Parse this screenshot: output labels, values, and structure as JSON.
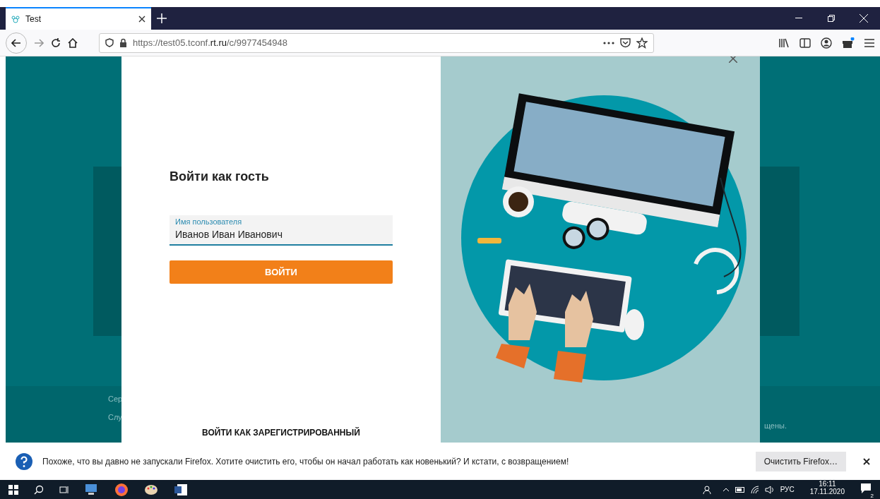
{
  "browser": {
    "tabs": [
      {
        "title": "Test",
        "selected": true
      }
    ],
    "url_prefix": "https://test05.tconf.",
    "url_domain": "rt.ru",
    "url_path": "/c/9977454948"
  },
  "background": {
    "footer_lines": [
      "Сер",
      "Слу"
    ],
    "copyright_tail": "щены."
  },
  "dialog": {
    "title": "Войти как гость",
    "field": {
      "label": "Имя пользователя",
      "value": "Иванов Иван Иванович"
    },
    "submit": "ВОЙТИ",
    "registered_link": "ВОЙТИ КАК ЗАРЕГИСТРИРОВАННЫЙ"
  },
  "notification": {
    "message": "Похоже, что вы давно не запускали Firefox. Хотите очистить его, чтобы он начал работать как новенький? И кстати, с возвращением!",
    "button": "Очистить Firefox…"
  },
  "taskbar": {
    "language": "РУС",
    "time": "16:11",
    "date": "17.11.2020",
    "notifications_count": "2"
  }
}
